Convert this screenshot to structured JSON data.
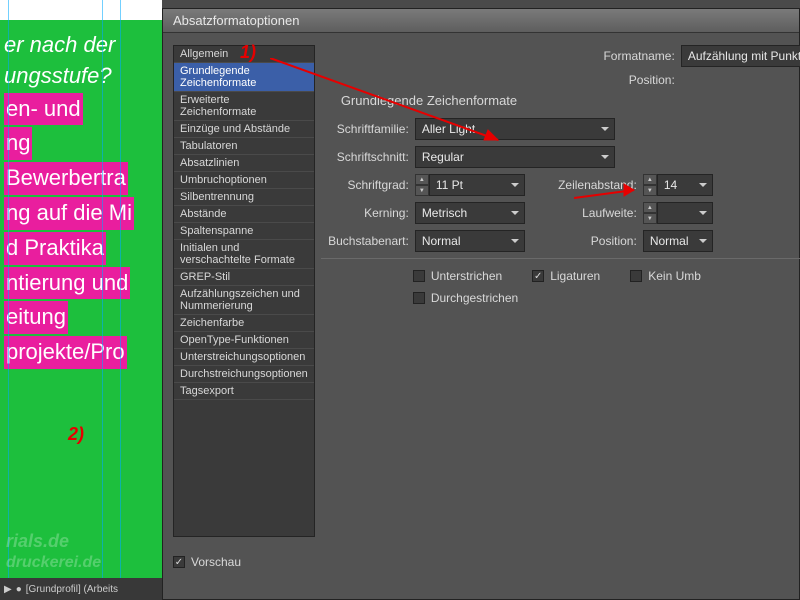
{
  "dialog": {
    "title": "Absatzformatoptionen",
    "formatname_label": "Formatname:",
    "formatname_value": "Aufzählung mit Punkt",
    "position_label": "Position:",
    "section": "Grundlegende Zeichenformate",
    "vorschau_label": "Vorschau"
  },
  "sidebar": {
    "items": [
      "Allgemein",
      "Grundlegende Zeichenformate",
      "Erweiterte Zeichenformate",
      "Einzüge und Abstände",
      "Tabulatoren",
      "Absatzlinien",
      "Umbruchoptionen",
      "Silbentrennung",
      "Abstände",
      "Spaltenspanne",
      "Initialen und verschachtelte Formate",
      "GREP-Stil",
      "Aufzählungszeichen und Nummerierung",
      "Zeichenfarbe",
      "OpenType-Funktionen",
      "Unterstreichungsoptionen",
      "Durchstreichungsoptionen",
      "Tagsexport"
    ],
    "selected": 1
  },
  "fields": {
    "schriftfamilie": {
      "label": "Schriftfamilie:",
      "value": "Aller Light"
    },
    "schriftschnitt": {
      "label": "Schriftschnitt:",
      "value": "Regular"
    },
    "schriftgrad": {
      "label": "Schriftgrad:",
      "value": "11 Pt"
    },
    "zeilenabstand": {
      "label": "Zeilenabstand:",
      "value": "14"
    },
    "kerning": {
      "label": "Kerning:",
      "value": "Metrisch"
    },
    "laufweite": {
      "label": "Laufweite:",
      "value": ""
    },
    "buchstabenart": {
      "label": "Buchstabenart:",
      "value": "Normal"
    },
    "position": {
      "label": "Position:",
      "value": "Normal"
    }
  },
  "checks": {
    "unterstrichen": "Unterstrichen",
    "ligaturen": "Ligaturen",
    "kein_umbruch": "Kein Umb",
    "durchgestrichen": "Durchgestrichen"
  },
  "annotations": {
    "a1": "1)",
    "a2": "2)"
  },
  "doc": {
    "l1": "er nach der",
    "l2": "ungsstufe?",
    "h1": "en- und",
    "h2": "ng",
    "h3": "Bewerbertra",
    "h4": "ng auf die Mi",
    "h5": "d Praktika",
    "h6": "ntierung und",
    "h7": "eitung",
    "h8": "projekte/Pro"
  },
  "status": {
    "profile": "[Grundprofil] (Arbeits"
  },
  "watermark": {
    "w1": "rials.de",
    "w2": "druckerei.de"
  }
}
